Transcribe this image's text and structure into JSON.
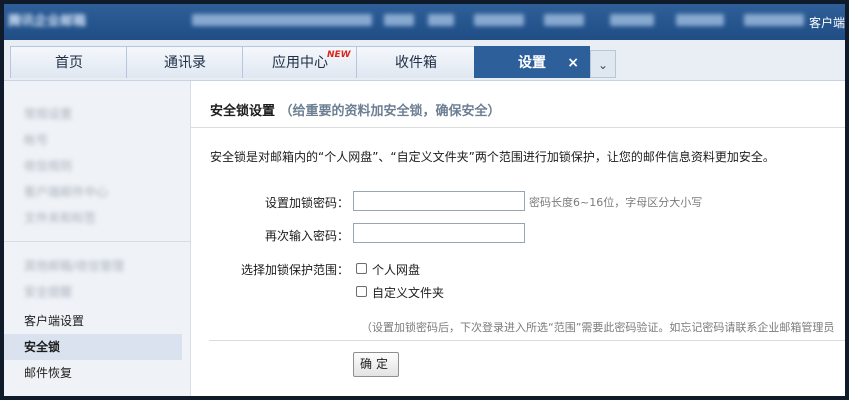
{
  "header": {
    "logo_text": "腾讯企业邮箱",
    "client_link": "客户端"
  },
  "tabs": [
    {
      "label": "首页"
    },
    {
      "label": "通讯录"
    },
    {
      "label": "应用中心",
      "badge": "NEW"
    },
    {
      "label": "收件箱"
    },
    {
      "label": "设置",
      "active": true
    }
  ],
  "tab_close": "×",
  "tab_more": "⌄",
  "sidebar": {
    "items": [
      {
        "label": "常规设置",
        "blurred": true
      },
      {
        "label": "帐号",
        "blurred": true
      },
      {
        "label": "收信规则",
        "blurred": true
      },
      {
        "label": "客户端邮件中心",
        "blurred": true
      },
      {
        "label": "文件夹和标签",
        "blurred": true
      },
      {
        "label": "其他邮箱/收信管理",
        "blurred": true
      },
      {
        "label": "安全提醒",
        "blurred": true
      },
      {
        "label": "客户端设置",
        "blurred": false
      },
      {
        "label": "安全锁",
        "blurred": false,
        "active": true
      },
      {
        "label": "邮件恢复",
        "blurred": false
      }
    ]
  },
  "main": {
    "title": "安全锁设置",
    "subtitle": "（给重要的资料加安全锁，确保安全）",
    "description": "安全锁是对邮箱内的“个人网盘”、“自定义文件夹”两个范围进行加锁保护，让您的邮件信息资料更加安全。",
    "password_label": "设置加锁密码：",
    "password_value": "",
    "password_hint": "密码长度6~16位，字母区分大小写",
    "confirm_label": "再次输入密码：",
    "confirm_value": "",
    "scope_label": "选择加锁保护范围：",
    "scope_options": [
      {
        "label": "个人网盘",
        "checked": false
      },
      {
        "label": "自定义文件夹",
        "checked": false
      }
    ],
    "note": "（设置加锁密码后，下次登录进入所选“范围”需要此密码验证。如忘记密码请联系企业邮箱管理员",
    "submit_label": "确定"
  }
}
